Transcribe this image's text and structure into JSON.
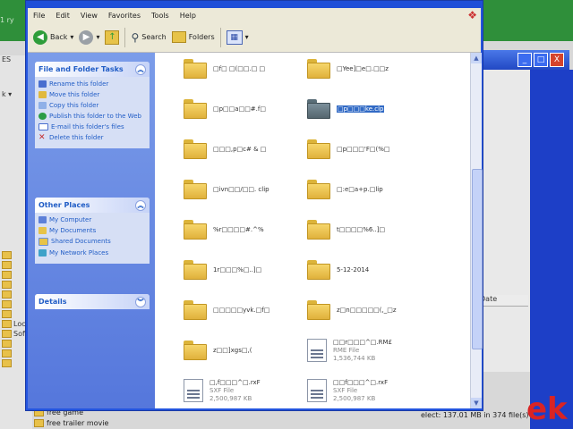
{
  "background": {
    "top_left_text": "1\nry",
    "left_label": "ES",
    "left_arrow": "k ▾",
    "tree_items": [
      "",
      "",
      "",
      "",
      "",
      "",
      "",
      "Loca",
      "Softw",
      "",
      "",
      ""
    ],
    "list_header": "Date",
    "bottom_items": [
      "free game",
      "free trailer movie"
    ],
    "status_text": "elect: 137.01 MB in 374 file(s)",
    "brand_text": "ek",
    "title_buttons": [
      "_",
      "□",
      "X"
    ]
  },
  "window": {
    "menu": [
      "File",
      "Edit",
      "View",
      "Favorites",
      "Tools",
      "Help"
    ],
    "toolbar": {
      "back_label": "Back",
      "search_label": "Search",
      "folders_label": "Folders"
    }
  },
  "task_pane": {
    "file_folder_tasks": {
      "header": "File and Folder Tasks",
      "items": [
        {
          "label": "Rename this folder",
          "icon": "rename-icon"
        },
        {
          "label": "Move this folder",
          "icon": "move-icon"
        },
        {
          "label": "Copy this folder",
          "icon": "copy-icon"
        },
        {
          "label": "Publish this folder to the Web",
          "icon": "publish-icon"
        },
        {
          "label": "E-mail this folder's files",
          "icon": "email-icon"
        },
        {
          "label": "Delete this folder",
          "icon": "delete-icon"
        }
      ]
    },
    "other_places": {
      "header": "Other Places",
      "items": [
        {
          "label": "My Computer",
          "icon": "computer-icon"
        },
        {
          "label": "My Documents",
          "icon": "documents-icon"
        },
        {
          "label": "Shared Documents",
          "icon": "shared-documents-icon"
        },
        {
          "label": "My Network Places",
          "icon": "network-icon"
        }
      ]
    },
    "details": {
      "header": "Details"
    }
  },
  "files": [
    {
      "name": "□f□ □(□□.□ □",
      "type": "folder"
    },
    {
      "name": "□Yee]□e□.□□z",
      "type": "folder"
    },
    {
      "name": "□p□□a□□#.f□",
      "type": "folder"
    },
    {
      "name": "□p□□□ke.clp",
      "type": "folder",
      "selected": true,
      "dark": true
    },
    {
      "name": "□□□,p□c# & □",
      "type": "folder"
    },
    {
      "name": "□p□□□'F□(%□",
      "type": "folder"
    },
    {
      "name": "□ivn□□/□□. clip",
      "type": "folder"
    },
    {
      "name": "□:e□a+p.□lip",
      "type": "folder"
    },
    {
      "name": "%r□□□□#.^%",
      "type": "folder"
    },
    {
      "name": "t□□□□%6..]□",
      "type": "folder"
    },
    {
      "name": "1r□□□%□..]□",
      "type": "folder"
    },
    {
      "name": "5-12-2014",
      "type": "folder"
    },
    {
      "name": "□□□□□yvk.□f□",
      "type": "folder"
    },
    {
      "name": "z□n□□□□□(,_□z",
      "type": "folder"
    },
    {
      "name": "z□□]xgs□,(",
      "type": "folder"
    },
    {
      "name": "□□r□□□^□.RM£",
      "type": "file",
      "sub1": "RME File",
      "sub2": "1,536,744 KB"
    },
    {
      "name": "□,f□□□^□.rxF",
      "type": "file",
      "sub1": "SXF File",
      "sub2": "2,500,987 KB"
    },
    {
      "name": "□□f□□□^□.rxF",
      "type": "file",
      "sub1": "SXF File",
      "sub2": "2,500,987 KB"
    }
  ]
}
